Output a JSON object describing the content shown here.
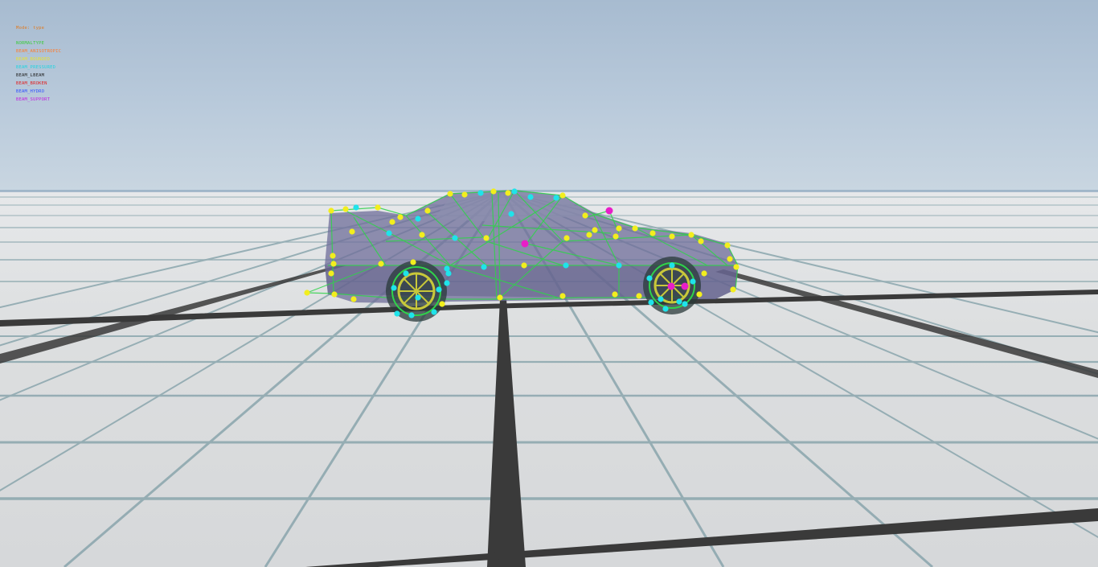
{
  "debug_overlay": {
    "mode_label": "Mode: type",
    "legend": [
      {
        "label": "NORMALTYPE",
        "color": "#3ccb3c"
      },
      {
        "label": "BEAM_ANISOTROPIC",
        "color": "#ff7a2a"
      },
      {
        "label": "BEAM_BOUNDED",
        "color": "#e8e030"
      },
      {
        "label": "BEAM_PRESSURED",
        "color": "#20d4e0"
      },
      {
        "label": "BEAM_LBEAM",
        "color": "#222222"
      },
      {
        "label": "BEAM_BROKEN",
        "color": "#e02020"
      },
      {
        "label": "BEAM_HYDRO",
        "color": "#3050ff"
      },
      {
        "label": "BEAM_SUPPORT",
        "color": "#c020e0"
      }
    ]
  },
  "colors": {
    "mode_label": "#e07a20",
    "node_default": "#f2ee1e",
    "node_pressured": "#1fe3ea",
    "node_special": "#e81ec8",
    "beam_normal": "#2fd34a",
    "car_body": "#6f6e9a"
  }
}
